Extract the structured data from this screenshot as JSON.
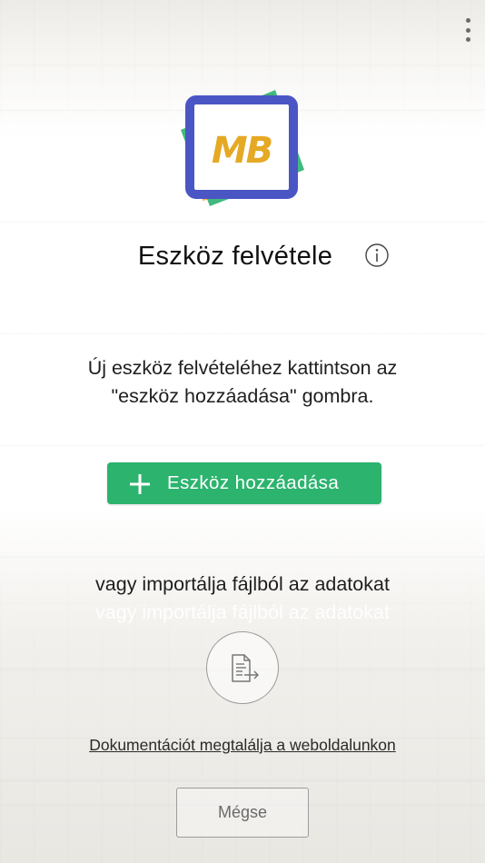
{
  "header": {
    "menu_icon": "more-vert-icon"
  },
  "logo": {
    "text": "MB",
    "colors": {
      "blue": "#4b56c5",
      "green": "#2db170",
      "orange": "#f0ac45",
      "letters": "#e5a924"
    }
  },
  "page": {
    "title": "Eszköz felvétele",
    "info_icon": "info-icon",
    "description_line1": "Új eszköz felvételéhez kattintson az",
    "description_line2": "\"eszköz hozzáadása\" gombra."
  },
  "add_button": {
    "label": "Eszköz hozzáadása",
    "icon": "plus-icon",
    "color": "#2cb36e"
  },
  "import": {
    "text": "vagy importálja fájlból az adatokat",
    "ghost_text": "vagy importálja fájlból az adatokat",
    "icon": "file-import-icon"
  },
  "documentation_link": "Dokumentációt megtalálja a weboldalunkon",
  "cancel_button": {
    "label": "Mégse"
  }
}
